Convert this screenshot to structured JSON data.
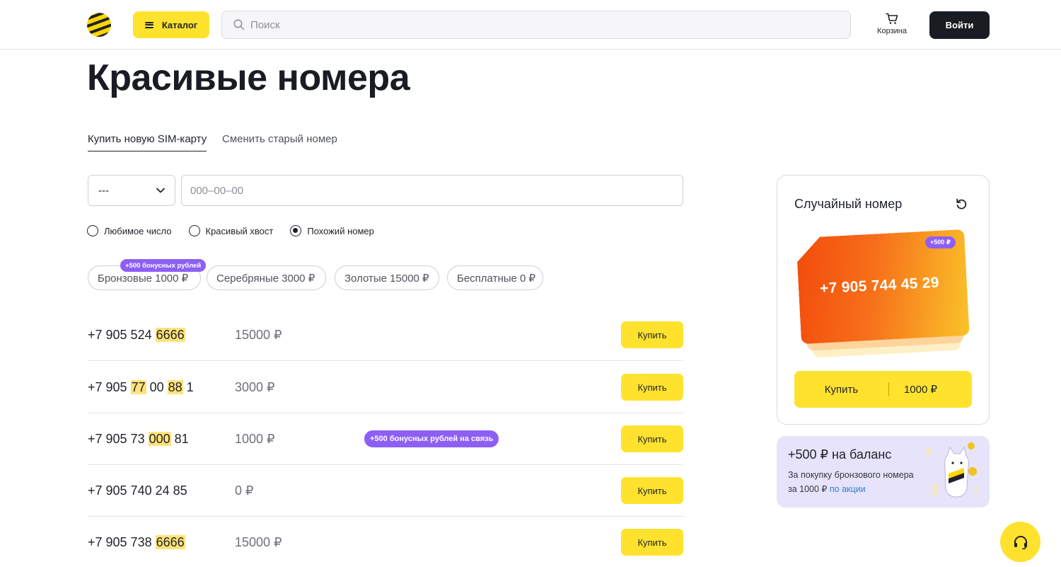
{
  "header": {
    "catalog_label": "Каталог",
    "search_placeholder": "Поиск",
    "cart_label": "Корзина",
    "login_label": "Войти"
  },
  "page_title": "Красивые номера",
  "tabs": [
    {
      "label": "Купить новую SIM-карту",
      "active": true
    },
    {
      "label": "Сменить старый номер",
      "active": false
    }
  ],
  "filters": {
    "code_value": "---",
    "number_placeholder": "000–00–00",
    "radios": [
      {
        "label": "Любимое число",
        "checked": false
      },
      {
        "label": "Красивый хвост",
        "checked": false
      },
      {
        "label": "Похожий номер",
        "checked": true
      }
    ],
    "chips": [
      {
        "label": "Бронзовые 1000 ₽"
      },
      {
        "label": "Серебряные 3000 ₽"
      },
      {
        "label": "Золотые 15000 ₽"
      },
      {
        "label": "Бесплатные 0 ₽"
      }
    ],
    "chip_badge": "+500 бонусных рублей"
  },
  "numbers": [
    {
      "parts": [
        "+7 905 524 ",
        "6666",
        ""
      ],
      "price": "15000 ₽",
      "buy_label": "Купить"
    },
    {
      "parts": [
        "+7 905 ",
        "77",
        " 00 ",
        "88",
        " 1"
      ],
      "price": "3000 ₽",
      "buy_label": "Купить"
    },
    {
      "parts": [
        "+7 905 73 ",
        "000",
        " 81"
      ],
      "price": "1000 ₽",
      "promo": "+500 бонусных рублей на связь",
      "buy_label": "Купить"
    },
    {
      "parts": [
        "+7 905 740 24 85"
      ],
      "price": "0 ₽",
      "buy_label": "Купить"
    },
    {
      "parts": [
        "+7 905 738 ",
        "6666",
        ""
      ],
      "price": "15000 ₽",
      "buy_label": "Купить"
    }
  ],
  "random_card": {
    "title": "Случайный номер",
    "sim_number": "+7 905 744 45 29",
    "sim_badge": "+500 ₽",
    "buy_label": "Купить",
    "buy_price": "1000 ₽"
  },
  "promo_card": {
    "title": "+500 ₽ на баланс",
    "text": "За покупку бронзового номера за 1000 ₽",
    "link": "по акции"
  },
  "colors": {
    "accent": "#ffe22e",
    "highlight": "#ffe37a",
    "badge": "#8d5ff5",
    "dark": "#191c22"
  }
}
